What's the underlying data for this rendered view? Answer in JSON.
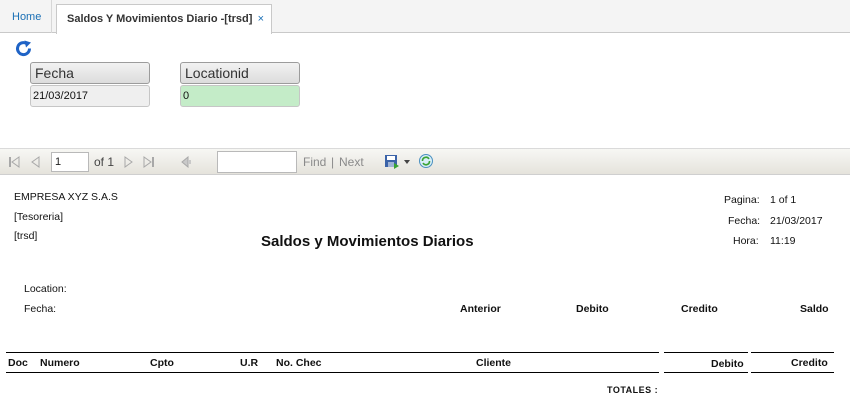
{
  "tabs": {
    "home_label": "Home",
    "active_label": "Saldos Y Movimientos Diario -[trsd]",
    "close_glyph": "×"
  },
  "params": {
    "fecha_label": "Fecha",
    "fecha_value": "21/03/2017",
    "location_label": "Locationid",
    "location_value": "0",
    "location_bg": "#c4ecc8"
  },
  "toolbar": {
    "page_value": "1",
    "of_text": "of 1",
    "find_label": "Find",
    "separator": "|",
    "next_label": "Next"
  },
  "report": {
    "company": "EMPRESA XYZ S.A.S",
    "department": "[Tesoreria]",
    "code": "[trsd]",
    "title": "Saldos y Movimientos Diarios",
    "pagina_label": "Pagina:",
    "pagina_value": "1 of 1",
    "fecha_label": "Fecha:",
    "fecha_value": "21/03/2017",
    "hora_label": "Hora:",
    "hora_value": "11:19",
    "location_label": "Location:",
    "fecha_row_label": "Fecha:",
    "summary_headers": {
      "anterior": "Anterior",
      "debito": "Debito",
      "credito": "Credito",
      "saldo": "Saldo"
    },
    "detail_headers": {
      "doc": "Doc",
      "numero": "Numero",
      "cpto": "Cpto",
      "ur": "U.R",
      "nochec": "No. Chec",
      "cliente": "Cliente",
      "debito": "Debito",
      "credito": "Credito"
    },
    "totales_label": "TOTALES :"
  }
}
